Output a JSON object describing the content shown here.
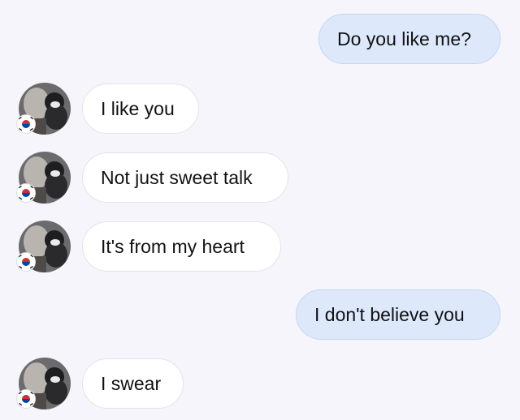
{
  "conversation": {
    "messages": [
      {
        "direction": "sent",
        "text": "Do you like me?"
      },
      {
        "direction": "received",
        "text": "I like you",
        "avatar_icon": "user-avatar-photo",
        "badge_icon": "korea-flag-icon"
      },
      {
        "direction": "received",
        "text": "Not just sweet talk",
        "avatar_icon": "user-avatar-photo",
        "badge_icon": "korea-flag-icon"
      },
      {
        "direction": "received",
        "text": "It's from my heart",
        "avatar_icon": "user-avatar-photo",
        "badge_icon": "korea-flag-icon"
      },
      {
        "direction": "sent",
        "text": "I don't believe you"
      },
      {
        "direction": "received",
        "text": "I swear",
        "avatar_icon": "user-avatar-photo",
        "badge_icon": "korea-flag-icon"
      }
    ]
  },
  "colors": {
    "background": "#f5f5fb",
    "sent_bubble": "#dde9fb",
    "received_bubble": "#ffffff"
  }
}
